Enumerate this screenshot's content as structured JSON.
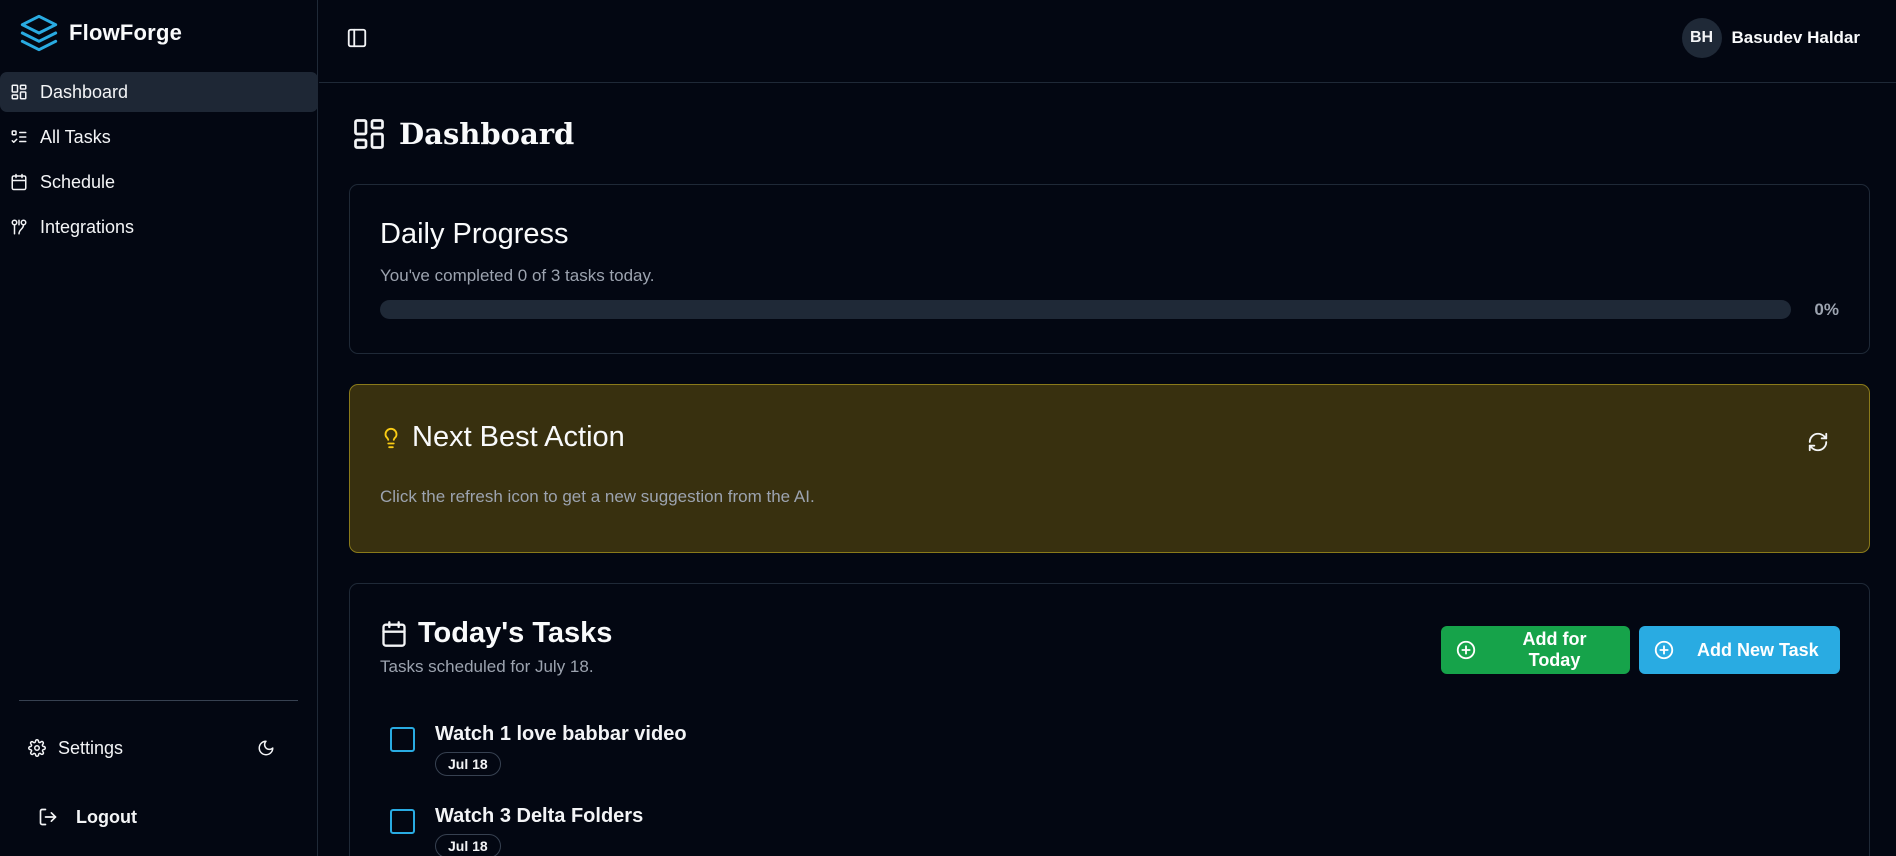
{
  "app": {
    "name": "FlowForge"
  },
  "sidebar": {
    "items": [
      {
        "label": "Dashboard",
        "icon": "dashboard-icon",
        "active": true
      },
      {
        "label": "All Tasks",
        "icon": "list-icon",
        "active": false
      },
      {
        "label": "Schedule",
        "icon": "calendar-icon",
        "active": false
      },
      {
        "label": "Integrations",
        "icon": "integrations-icon",
        "active": false
      }
    ],
    "settings_label": "Settings",
    "logout_label": "Logout"
  },
  "header": {
    "user": {
      "initials": "BH",
      "name": "Basudev Haldar"
    }
  },
  "main": {
    "title": "Dashboard",
    "progress": {
      "title": "Daily Progress",
      "subtitle": "You've completed 0 of 3 tasks today.",
      "percent_label": "0%",
      "percent": 0
    },
    "action": {
      "title": "Next Best Action",
      "text": "Click the refresh icon to get a new suggestion from the AI."
    },
    "tasks": {
      "title": "Today's Tasks",
      "subtitle": "Tasks scheduled for July 18.",
      "add_today_label": "Add for Today",
      "add_new_label": "Add New Task",
      "items": [
        {
          "title": "Watch 1 love babbar video",
          "date": "Jul 18"
        },
        {
          "title": "Watch 3 Delta Folders",
          "date": "Jul 18"
        }
      ]
    }
  },
  "colors": {
    "background": "#030712",
    "accent_blue": "#29abe2",
    "accent_green": "#16a34a",
    "action_bg": "#38300f",
    "action_icon": "#facc15"
  }
}
